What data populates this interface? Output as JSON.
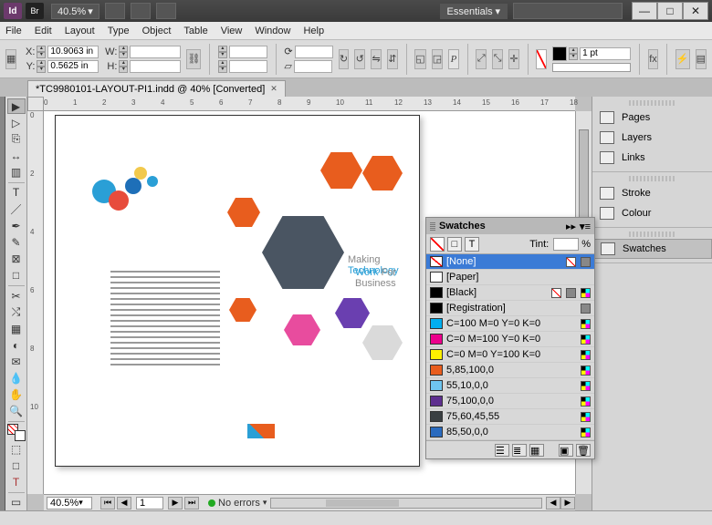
{
  "titlebar": {
    "app": "Id",
    "bridge": "Br",
    "zoom": "40.5%",
    "workspace": "Essentials"
  },
  "win": {
    "min": "—",
    "max": "□",
    "close": "✕"
  },
  "menu": [
    "File",
    "Edit",
    "Layout",
    "Type",
    "Object",
    "Table",
    "View",
    "Window",
    "Help"
  ],
  "control": {
    "x_label": "X:",
    "x": "10.9063 in",
    "y_label": "Y:",
    "y": "0.5625 in",
    "w_label": "W:",
    "w": "",
    "h_label": "H:",
    "h": "",
    "stroke_pt": "1 pt"
  },
  "tab": {
    "name": "*TC9980101-LAYOUT-PI1.indd @ 40% [Converted]"
  },
  "rulerH": [
    "0",
    "1",
    "2",
    "3",
    "4",
    "5",
    "6",
    "7",
    "8",
    "9",
    "10",
    "11",
    "12",
    "13",
    "14",
    "15",
    "16",
    "17",
    "18"
  ],
  "rulerV": [
    "0",
    "2",
    "4",
    "6",
    "8",
    "10"
  ],
  "art": {
    "line1a": "Making ",
    "line1b": "Technology",
    "line2a": "Work ",
    "line2b": "For Business"
  },
  "hscroll": {
    "zoom": "40.5%",
    "page": "1",
    "errors": "No errors"
  },
  "dock": {
    "pages": "Pages",
    "layers": "Layers",
    "links": "Links",
    "stroke": "Stroke",
    "colour": "Colour",
    "swatches": "Swatches"
  },
  "swatches": {
    "title": "Swatches",
    "tint_label": "Tint:",
    "tint_unit": "%",
    "rows": [
      {
        "name": "[None]",
        "color": "none",
        "sel": true,
        "lock": true,
        "cmyk": false,
        "nonet": true
      },
      {
        "name": "[Paper]",
        "color": "#ffffff",
        "sel": false,
        "lock": false,
        "cmyk": false,
        "nonet": false
      },
      {
        "name": "[Black]",
        "color": "#000000",
        "sel": false,
        "lock": true,
        "cmyk": true,
        "nonet": true
      },
      {
        "name": "[Registration]",
        "color": "#000000",
        "sel": false,
        "lock": true,
        "cmyk": false,
        "nonet": false
      },
      {
        "name": "C=100 M=0 Y=0 K=0",
        "color": "#00aeef",
        "sel": false,
        "lock": false,
        "cmyk": true,
        "nonet": false
      },
      {
        "name": "C=0 M=100 Y=0 K=0",
        "color": "#ec008c",
        "sel": false,
        "lock": false,
        "cmyk": true,
        "nonet": false
      },
      {
        "name": "C=0 M=0 Y=100 K=0",
        "color": "#fff200",
        "sel": false,
        "lock": false,
        "cmyk": true,
        "nonet": false
      },
      {
        "name": "5,85,100,0",
        "color": "#e85d1e",
        "sel": false,
        "lock": false,
        "cmyk": true,
        "nonet": false
      },
      {
        "name": "55,10,0,0",
        "color": "#6fc5ef",
        "sel": false,
        "lock": false,
        "cmyk": true,
        "nonet": false
      },
      {
        "name": "75,100,0,0",
        "color": "#5e2f8f",
        "sel": false,
        "lock": false,
        "cmyk": true,
        "nonet": false
      },
      {
        "name": "75,60,45,55",
        "color": "#3a3f42",
        "sel": false,
        "lock": false,
        "cmyk": true,
        "nonet": false
      },
      {
        "name": "85,50,0,0",
        "color": "#2a6bbf",
        "sel": false,
        "lock": false,
        "cmyk": true,
        "nonet": false
      }
    ]
  }
}
